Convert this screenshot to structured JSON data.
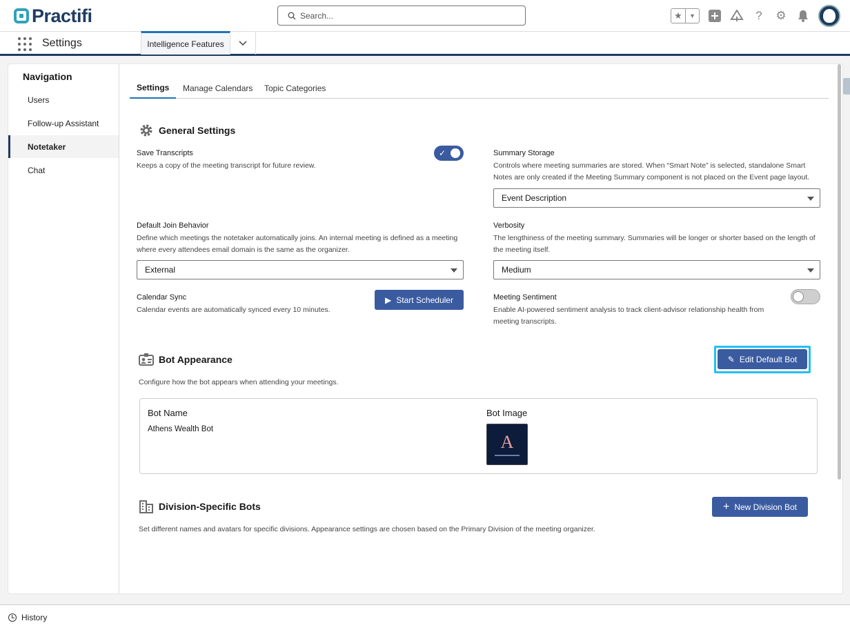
{
  "header": {
    "brand": "Practifi",
    "search_placeholder": "Search...",
    "icons": [
      "favorites-star-icon",
      "favorites-dropdown-icon",
      "add-icon",
      "trailhead-icon",
      "help-icon",
      "setup-gear-icon",
      "notifications-bell-icon",
      "user-avatar"
    ]
  },
  "appbar": {
    "app_name": "Settings",
    "active_tab": "Intelligence Features"
  },
  "nav": {
    "title": "Navigation",
    "items": [
      {
        "label": "Users",
        "active": false
      },
      {
        "label": "Follow-up Assistant",
        "active": false
      },
      {
        "label": "Notetaker",
        "active": true
      },
      {
        "label": "Chat",
        "active": false
      }
    ]
  },
  "subtabs": [
    "Settings",
    "Manage Calendars",
    "Topic Categories"
  ],
  "general": {
    "title": "General Settings",
    "save_transcripts": {
      "label": "Save Transcripts",
      "desc": "Keeps a copy of the meeting transcript for future review.",
      "enabled": true
    },
    "summary_storage": {
      "label": "Summary Storage",
      "desc": "Controls where meeting summaries are stored. When “Smart Note” is selected, standalone Smart Notes are only created if the Meeting Summary component is not placed on the Event page layout.",
      "value": "Event Description"
    },
    "default_join": {
      "label": "Default Join Behavior",
      "desc": "Define which meetings the notetaker automatically joins. An internal meeting is defined as a meeting where every attendees email domain is the same as the organizer.",
      "value": "External"
    },
    "verbosity": {
      "label": "Verbosity",
      "desc": "The lengthiness of the meeting summary. Summaries will be longer or shorter based on the length of the meeting itself.",
      "value": "Medium"
    },
    "calendar_sync": {
      "label": "Calendar Sync",
      "desc": "Calendar events are automatically synced every 10 minutes.",
      "button": "Start Scheduler"
    },
    "meeting_sentiment": {
      "label": "Meeting Sentiment",
      "desc": "Enable AI-powered sentiment analysis to track client-advisor relationship health from meeting transcripts.",
      "enabled": false
    }
  },
  "bot_appearance": {
    "title": "Bot Appearance",
    "desc": "Configure how the bot appears when attending your meetings.",
    "edit_button": "Edit Default Bot",
    "name_header": "Bot Name",
    "name_value": "Athens Wealth Bot",
    "image_header": "Bot Image",
    "image_letter": "A"
  },
  "division_bots": {
    "title": "Division-Specific Bots",
    "desc": "Set different names and avatars for specific divisions. Appearance settings are chosen based on the Primary Division of the meeting organizer.",
    "new_button": "New Division Bot"
  },
  "footer": {
    "history": "History"
  },
  "colors": {
    "primary_button": "#3a5ba0",
    "focus_ring": "#22c1ee",
    "brand_navy": "#1f3b63",
    "brand_teal": "#2ea3b8"
  }
}
